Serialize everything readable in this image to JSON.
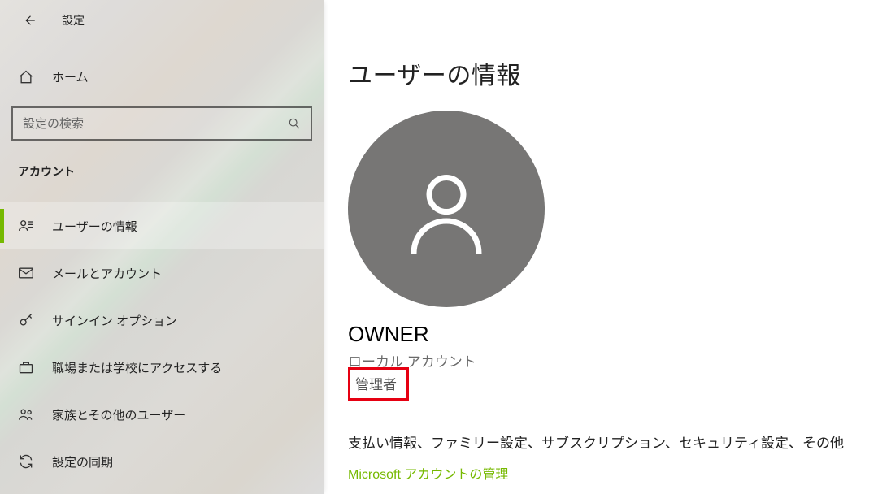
{
  "header": {
    "title": "設定"
  },
  "home_label": "ホーム",
  "search": {
    "placeholder": "設定の検索"
  },
  "category_label": "アカウント",
  "nav": [
    {
      "key": "user-info",
      "label": "ユーザーの情報",
      "icon": "user-badge-icon",
      "active": true
    },
    {
      "key": "email",
      "label": "メールとアカウント",
      "icon": "mail-icon",
      "active": false
    },
    {
      "key": "signin",
      "label": "サインイン オプション",
      "icon": "key-icon",
      "active": false
    },
    {
      "key": "work-school",
      "label": "職場または学校にアクセスする",
      "icon": "briefcase-icon",
      "active": false
    },
    {
      "key": "family",
      "label": "家族とその他のユーザー",
      "icon": "people-icon",
      "active": false
    },
    {
      "key": "sync",
      "label": "設定の同期",
      "icon": "sync-icon",
      "active": false
    }
  ],
  "main": {
    "page_title": "ユーザーの情報",
    "user_name": "OWNER",
    "account_type": "ローカル アカウント",
    "role": "管理者",
    "description": "支払い情報、ファミリー設定、サブスクリプション、セキュリティ設定、その他",
    "manage_link": "Microsoft アカウントの管理"
  }
}
